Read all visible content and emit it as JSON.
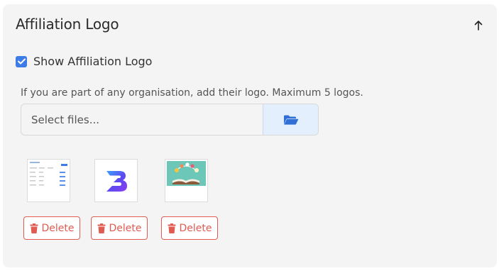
{
  "section": {
    "title": "Affiliation Logo",
    "collapse_icon": "arrow-up-icon"
  },
  "checkbox": {
    "label": "Show Affiliation Logo",
    "checked": true
  },
  "help_text": "If you are part of any organisation, add their logo. Maximum 5 logos.",
  "file_input": {
    "placeholder": "Select files...",
    "browse_icon": "folder-open-icon"
  },
  "logos": [
    {
      "name": "table-screenshot-logo",
      "delete_label": "Delete"
    },
    {
      "name": "b-brand-logo",
      "delete_label": "Delete"
    },
    {
      "name": "book-illustration-logo",
      "delete_label": "Delete"
    }
  ],
  "colors": {
    "accent": "#3d7be6",
    "danger": "#e05b52",
    "browse_bg": "#e3effd"
  }
}
